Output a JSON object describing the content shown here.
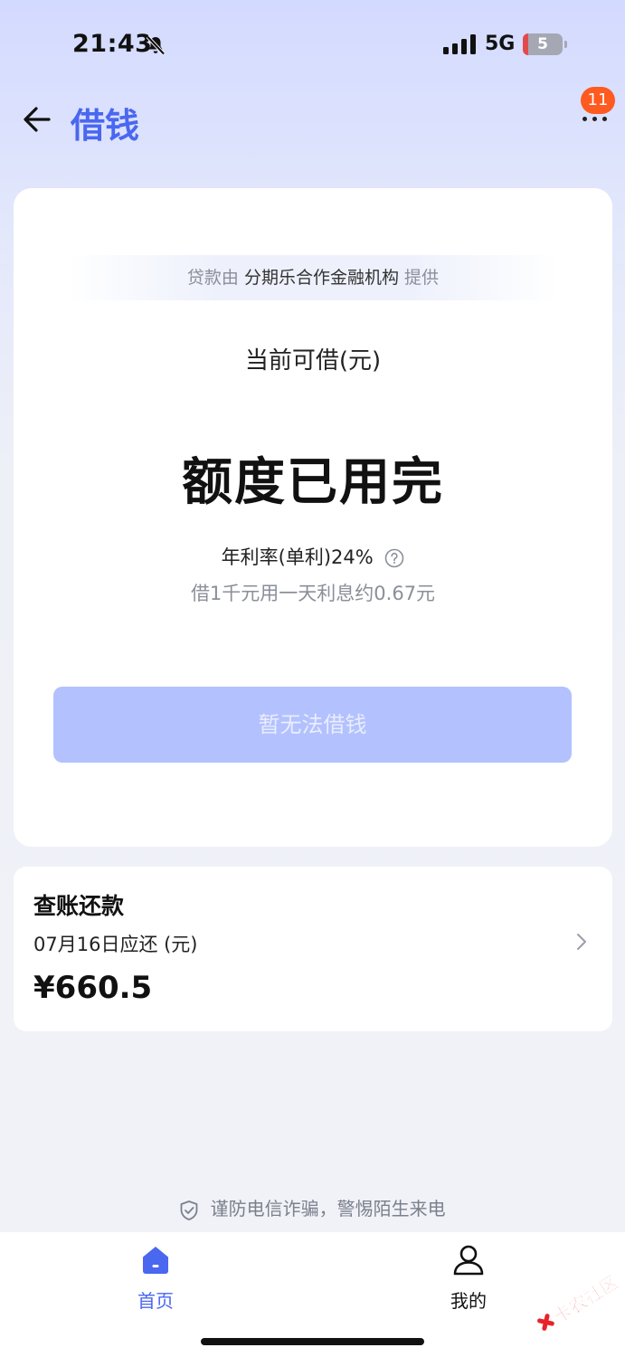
{
  "status_bar": {
    "time": "21:43",
    "network": "5G",
    "battery_level": "5"
  },
  "nav": {
    "title": "借钱",
    "badge_count": "11"
  },
  "loan_card": {
    "provider_prefix": "贷款由",
    "provider_name": "分期乐合作金融机构",
    "provider_suffix": "提供",
    "available_label": "当前可借(元)",
    "quota_status": "额度已用完",
    "annual_rate": "年利率(单利)24%",
    "interest_note": "借1千元用一天利息约0.67元",
    "borrow_button_label": "暂无法借钱"
  },
  "repay_card": {
    "title": "查账还款",
    "due_label": "07月16日应还 (元)",
    "amount": "¥660.5"
  },
  "fraud_notice": "谨防电信诈骗，警惕陌生来电",
  "tab_bar": {
    "tabs": [
      {
        "label": "首页",
        "active": true
      },
      {
        "label": "我的",
        "active": false
      }
    ]
  },
  "watermark": "卡农社区",
  "colors": {
    "accent": "#4a67f0",
    "badge": "#ff5a1f",
    "button_disabled": "#b3c1fe",
    "muted_text": "#8a8f99"
  },
  "icons": {
    "bell": "bell-muted-icon",
    "back": "arrow-left-icon",
    "more": "more-dots-icon",
    "help": "question-circle-icon",
    "chevron": "chevron-right-icon",
    "shield": "shield-check-icon",
    "home": "home-icon",
    "mine": "user-icon"
  }
}
